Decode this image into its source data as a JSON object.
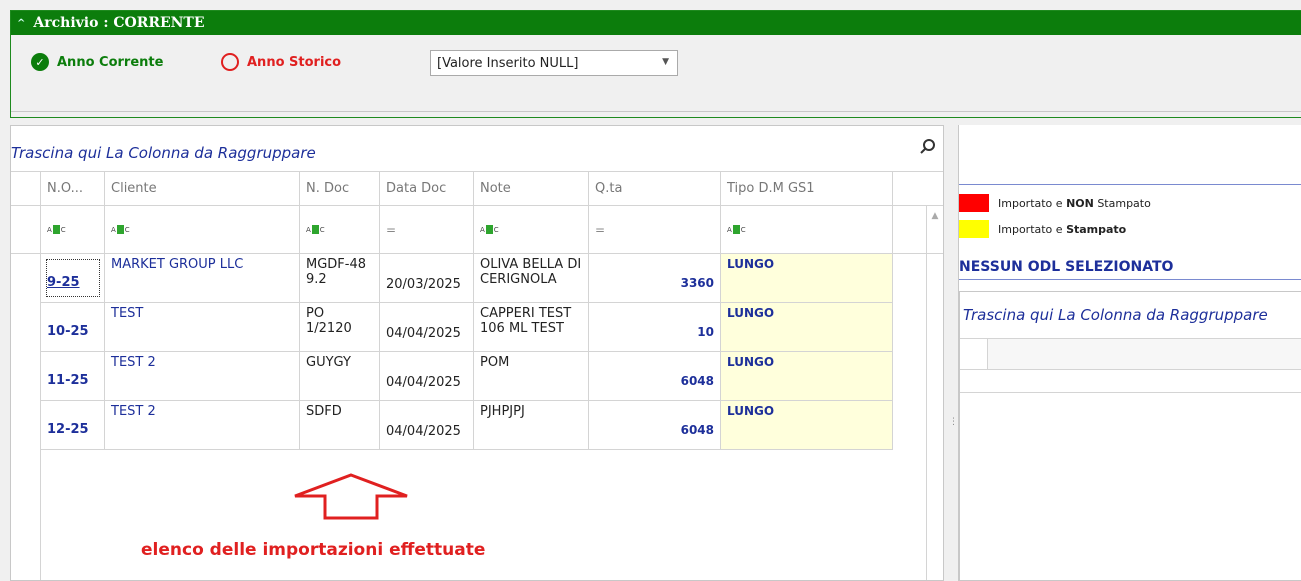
{
  "archive": {
    "collapse_glyph": "^",
    "title": "Archivio : CORRENTE",
    "option_current": "Anno Corrente",
    "option_history": "Anno Storico",
    "select_value": "[Valore Inserito NULL]",
    "colors": {
      "header": "#0c7d0c",
      "current": "#0c7d0c",
      "history": "#e02020"
    }
  },
  "grid": {
    "group_hint": "Trascina qui La Colonna da Raggruppare",
    "columns": [
      "N.O...",
      "Cliente",
      "N. Doc",
      "Data Doc",
      "Note",
      "Q.ta",
      "Tipo D.M GS1"
    ],
    "rows": [
      {
        "no": "9-25",
        "cliente": "MARKET GROUP LLC",
        "ndoc": "MGDF-48 9.2",
        "data": "20/03/2025",
        "note": "OLIVA BELLA DI CERIGNOLA",
        "qta": "3360",
        "tipo": "LUNGO"
      },
      {
        "no": "10-25",
        "cliente": "TEST",
        "ndoc": "PO 1/2120",
        "data": "04/04/2025",
        "note": "CAPPERI TEST 106 ML TEST",
        "qta": "10",
        "tipo": "LUNGO"
      },
      {
        "no": "11-25",
        "cliente": "TEST 2",
        "ndoc": "GUYGY",
        "data": "04/04/2025",
        "note": "POM",
        "qta": "6048",
        "tipo": "LUNGO"
      },
      {
        "no": "12-25",
        "cliente": "TEST 2",
        "ndoc": "SDFD",
        "data": "04/04/2025",
        "note": "PJHPJPJ",
        "qta": "6048",
        "tipo": "LUNGO"
      }
    ]
  },
  "annotation": {
    "caption": "elenco delle importazioni effettuate",
    "color": "#e02020"
  },
  "legend": {
    "items": [
      {
        "prefix": "Importato e ",
        "bold": "NON",
        "suffix": " Stampato",
        "color": "#ff0000"
      },
      {
        "prefix": "Importato e ",
        "bold": "Stampato",
        "suffix": "",
        "color": "#ffff00"
      }
    ]
  },
  "detail": {
    "status": "NESSUN ODL SELEZIONATO",
    "group_hint": "Trascina qui La Colonna da Raggruppare"
  }
}
